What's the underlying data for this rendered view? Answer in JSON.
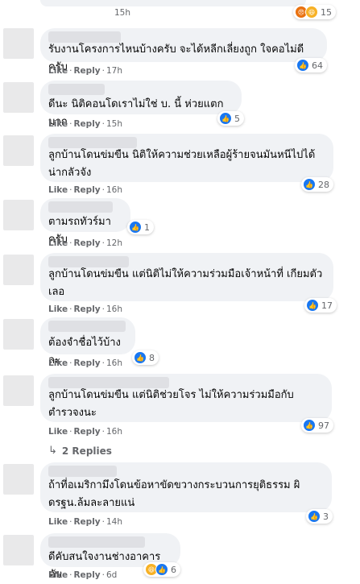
{
  "action_like": "Like",
  "action_reply": "Reply",
  "replies_label": "2 Replies",
  "top": {
    "time": "15h",
    "reactions": [
      "angry",
      "haha"
    ],
    "count": "15"
  },
  "comments": [
    {
      "text": "รับงานโครงการไหนบ้างครับ จะได้หลีกเลี่ยงถูก ใจคอไม่ดีครับ",
      "time": "17h",
      "reactions": [
        "like"
      ],
      "count": "64"
    },
    {
      "text": "ดีนะ นิติคอนโดเราไม่ใช่ บ. นี้ ห่วยแตกมาก",
      "time": "15h",
      "reactions": [
        "like"
      ],
      "count": "5"
    },
    {
      "text": "ลูกบ้านโดนข่มขืน นิติให้ความช่วยเหลือผู้ร้ายจนมันหนีไปได้ น่ากลัวจัง",
      "time": "16h",
      "reactions": [
        "like"
      ],
      "count": "28"
    },
    {
      "text": "ตามรถทัวร์มาครับ",
      "time": "12h",
      "reactions": [
        "like"
      ],
      "count": "1"
    },
    {
      "text": "ลูกบ้านโดนข่มขืน แต่นิติไม่ให้ความร่วมมือเจ้าหน้าที่ เกียมตัวเลอ",
      "time": "16h",
      "reactions": [
        "like"
      ],
      "count": "17"
    },
    {
      "text": "ต้องจำชื่อไว้บ้างละ",
      "time": "16h",
      "reactions": [
        "like"
      ],
      "count": "8"
    },
    {
      "text": "ลูกบ้านโดนข่มขืน แต่นิติช่วยโจร ไม่ให้ความร่วมมือกับตำรวจงนะ",
      "time": "16h",
      "reactions": [
        "like"
      ],
      "count": "97"
    },
    {
      "text": "ถ้าที่อเมริกามึงโดนข้อหาขัดขวางกระบวนการยุติธรรม ผิดรฐน.ล้มละลายแน่",
      "time": "14h",
      "reactions": [
        "like"
      ],
      "count": "3"
    },
    {
      "text": "ดีคับสนใจงานช่างอาคารคับ",
      "time": "6d",
      "reactions": [
        "haha",
        "like"
      ],
      "count": "6"
    }
  ]
}
